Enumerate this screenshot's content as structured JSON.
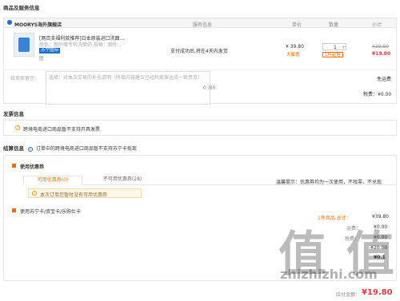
{
  "section_product": {
    "title": "商品及服务信息"
  },
  "table_headers": {
    "store": "MOORYS海外旗舰店",
    "service": "服务信息",
    "unit_price": "单价",
    "quantity": "数量",
    "subtotal": "小计"
  },
  "product": {
    "title": "[两百支福利款推荐]日本原装进口洗面...",
    "attrs": "颜色：额外赠专科洗面奶  规格：额外...",
    "image_note": "图",
    "global_tag": "苏宁国际",
    "service_info": "支付成功后,将在4天内发货",
    "price": "¥ 39.80",
    "price_tag": "大聚惠",
    "qty": "1",
    "qty_minus": "-",
    "qty_plus": "+",
    "qty_tag": "1件起售",
    "orig_subtotal": "¥39.80",
    "subtotal": "¥19.80"
  },
  "message": {
    "label": "给卖家留言：",
    "placeholder": "选填：对本次交易的补充说明（所填内容建议已经和卖家达成一致意见）",
    "counter": "0 /85",
    "shipping_label": "免运费",
    "tax_label": "税费：¥0.00"
  },
  "section_invoice": {
    "title": "发票信息",
    "notice": "跨境电商进口商品暂不支持开具发票"
  },
  "section_settle": {
    "title": "结算信息",
    "notice": "订单中的跨境电商进口商品暂不支持苏宁卡抵现"
  },
  "coupon": {
    "title": "使用优惠券",
    "tab_available": "可用优惠券(0)",
    "tab_unavailable": "不可用优惠券(28)",
    "tip": "温馨提示：优惠券均为一次使用，不找零、不兑现",
    "empty_notice": "本次订单您暂时没有可用优惠券"
  },
  "cards": {
    "title": "使用苏宁卡/资宝卡/乐购仕卡"
  },
  "summary": {
    "items_label": "1件商品  总计：",
    "items_value": "¥39.80",
    "shipping_label": "运费：",
    "shipping_value": "¥0.00",
    "tax_label": "税费：",
    "tax_value": "¥0.00",
    "discount_value": "-¥20.00",
    "extra_value": "¥0.1",
    "payable_label": "应付金额：",
    "payable_value": "¥19.80"
  },
  "watermark": {
    "big": "值 值",
    "site": "zhizhizhi.com"
  },
  "colors": {
    "accent": "#ff6a00",
    "price_red": "#e4393c",
    "brand_blue": "#1a6fd1"
  }
}
